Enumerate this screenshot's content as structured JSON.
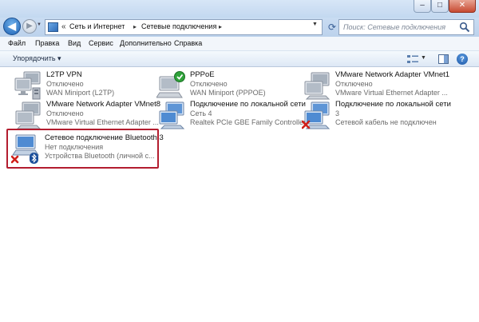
{
  "window": {
    "minimize_glyph": "–",
    "maximize_glyph": "□",
    "close_glyph": "✕"
  },
  "address": {
    "chevron": "«",
    "crumbs": [
      "Сеть и Интернет",
      "Сетевые подключения"
    ],
    "separator": "▸",
    "search_placeholder": "Поиск: Сетевые подключения"
  },
  "menu": {
    "file": "Файл",
    "edit": "Правка",
    "view": "Вид",
    "tools": "Сервис",
    "advanced": "Дополнительно",
    "help": "Справка"
  },
  "toolbar": {
    "organize": "Упорядочить ▾",
    "help_glyph": "?"
  },
  "connections": [
    {
      "name": "L2TP VPN",
      "status": "Отключено",
      "device": "WAN Miniport (L2TP)",
      "state": "vpn"
    },
    {
      "name": "PPPoE",
      "status": "Отключено",
      "device": "WAN Miniport (PPPOE)",
      "state": "connected-check"
    },
    {
      "name": "VMware Network Adapter VMnet1",
      "status": "Отключено",
      "device": "VMware Virtual Ethernet Adapter ...",
      "state": "disabled"
    },
    {
      "name": "VMware Network Adapter VMnet8",
      "status": "Отключено",
      "device": "VMware Virtual Ethernet Adapter ...",
      "state": "disabled"
    },
    {
      "name": "Подключение по локальной сети",
      "status": "Сеть  4",
      "device": "Realtek PCIe GBE Family Controller",
      "state": "connected"
    },
    {
      "name": "Подключение по локальной сети",
      "status": "3",
      "device": "Сетевой кабель не подключен",
      "state": "error"
    },
    {
      "name": "Сетевое подключение Bluetooth 3",
      "status": "Нет подключения",
      "device": "Устройства Bluetooth (личной с...",
      "state": "bluetooth-error"
    }
  ],
  "colors": {
    "highlight": "#b31d2f",
    "error_x": "#d0201a",
    "check": "#2fa23a"
  }
}
